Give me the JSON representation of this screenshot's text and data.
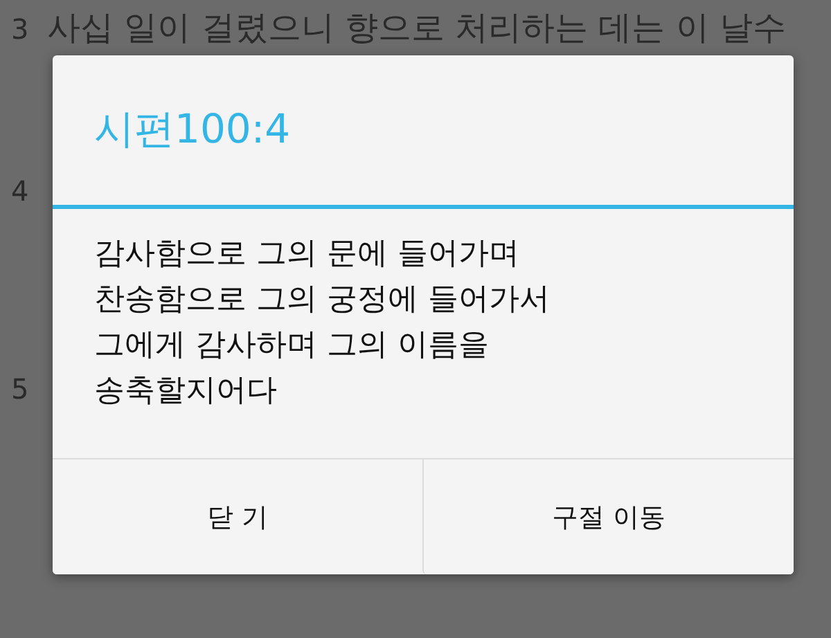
{
  "background_text": {
    "verses": [
      {
        "number": "3",
        "text": "사십 일이 걸렸으니 향으로 처리하는 데는 이 날수"
      },
      {
        "number": "4"
      },
      {
        "number": "5"
      }
    ]
  },
  "dialog": {
    "title": "시편100:4",
    "body": "감사함으로 그의 문에 들어가며\n찬송함으로 그의 궁정에 들어가서\n그에게 감사하며 그의 이름을\n송축할지어다",
    "buttons": [
      "닫 기",
      "구절 이동"
    ]
  }
}
